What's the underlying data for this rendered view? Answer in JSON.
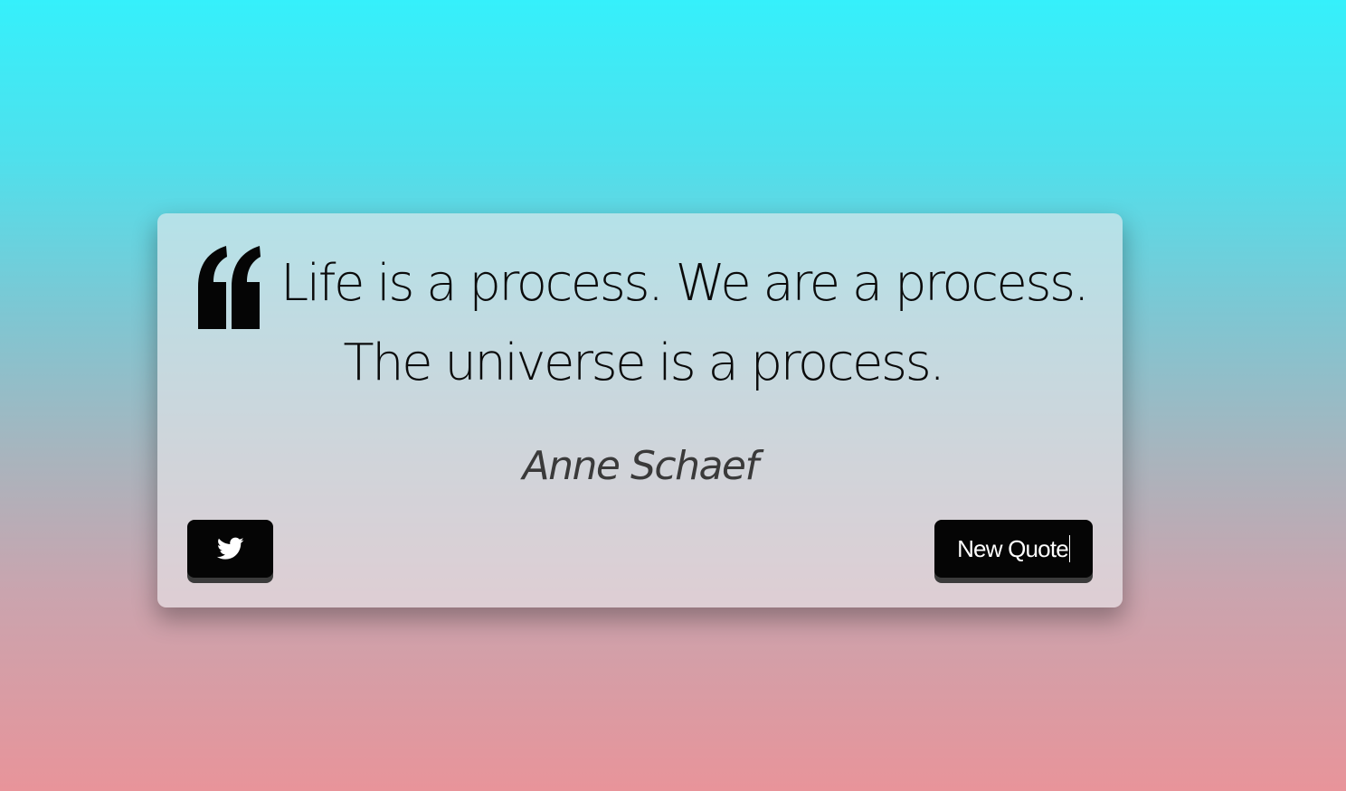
{
  "quote": {
    "text": "Life is a process. We are a process. The universe is a process.",
    "author": "Anne Schaef"
  },
  "buttons": {
    "tweet_icon": "twitter-bird-icon",
    "new_quote_label": "New Quote"
  },
  "icons": {
    "quote_mark": "quote-left-icon"
  },
  "colors": {
    "background_top": "#35f0fb",
    "background_bottom": "#e8949a",
    "button_bg": "#050505",
    "button_text": "#ffffff",
    "quote_text": "#0b0b0b",
    "author_text": "#3a3a3a"
  }
}
